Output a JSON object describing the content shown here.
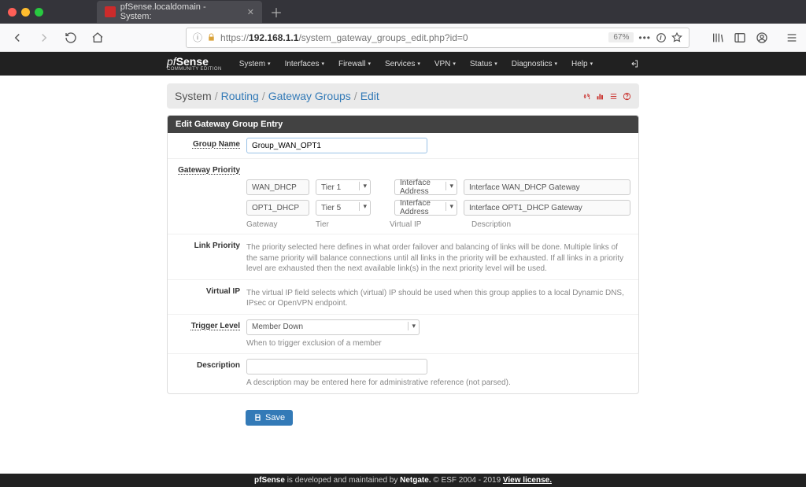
{
  "browser": {
    "tab_title": "pfSense.localdomain - System:",
    "url_prefix": "https://",
    "url_host": "192.168.1.1",
    "url_path": "/system_gateway_groups_edit.php?id=0",
    "zoom": "67%"
  },
  "topnav": {
    "brand": "pfSense",
    "sub": "COMMUNITY EDITION",
    "items": [
      "System",
      "Interfaces",
      "Firewall",
      "Services",
      "VPN",
      "Status",
      "Diagnostics",
      "Help"
    ]
  },
  "breadcrumb": {
    "root": "System",
    "parts": [
      "Routing",
      "Gateway Groups",
      "Edit"
    ]
  },
  "panel": {
    "title": "Edit Gateway Group Entry",
    "labels": {
      "group_name": "Group Name",
      "gateway_priority": "Gateway Priority",
      "link_priority": "Link Priority",
      "virtual_ip": "Virtual IP",
      "trigger_level": "Trigger Level",
      "description": "Description"
    },
    "group_name_value": "Group_WAN_OPT1",
    "gw_rows": [
      {
        "gateway": "WAN_DHCP",
        "tier": "Tier 1",
        "vip": "Interface Address",
        "desc": "Interface WAN_DHCP Gateway"
      },
      {
        "gateway": "OPT1_DHCP",
        "tier": "Tier 5",
        "vip": "Interface Address",
        "desc": "Interface OPT1_DHCP Gateway"
      }
    ],
    "gw_headers": {
      "gateway": "Gateway",
      "tier": "Tier",
      "vip": "Virtual IP",
      "desc": "Description"
    },
    "link_priority_text": "The priority selected here defines in what order failover and balancing of links will be done. Multiple links of the same priority will balance connections until all links in the priority will be exhausted. If all links in a priority level are exhausted then the next available link(s) in the next priority level will be used.",
    "virtual_ip_text": "The virtual IP field selects which (virtual) IP should be used when this group applies to a local Dynamic DNS, IPsec or OpenVPN endpoint.",
    "trigger_value": "Member Down",
    "trigger_help": "When to trigger exclusion of a member",
    "description_value": "",
    "description_help": "A description may be entered here for administrative reference (not parsed).",
    "save_label": "Save"
  },
  "footer": {
    "pre": "pfSense",
    "mid": " is developed and maintained by ",
    "netgate": "Netgate.",
    "copy": " © ESF 2004 - 2019 ",
    "license": "View license."
  }
}
